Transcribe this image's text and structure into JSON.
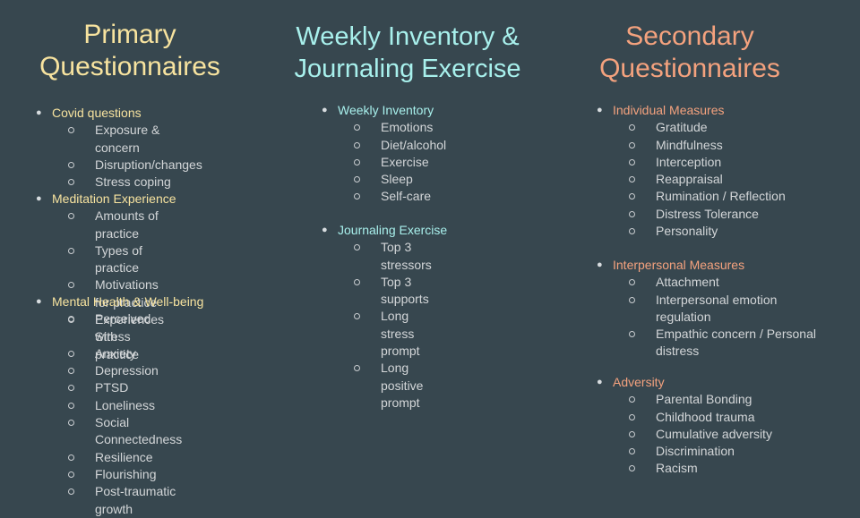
{
  "primary": {
    "title_line1": "Primary",
    "title_line2": "Questionnaires",
    "sections": [
      {
        "label": "Covid questions",
        "items": [
          "Exposure & concern",
          "Disruption/changes",
          "Stress coping"
        ]
      },
      {
        "label": "Meditation Experience",
        "items": [
          "Amounts of practice",
          "Types of practice",
          "Motivations for practice",
          "Experiences with practice"
        ]
      },
      {
        "label": "Mental Health & Well-being",
        "items": [
          "Perceived Stress",
          "Anxiety",
          "Depression",
          "PTSD",
          "Loneliness",
          "Social Connectedness",
          "Resilience",
          "Flourishing",
          "Post-traumatic growth"
        ]
      }
    ]
  },
  "weekly": {
    "title_line1": "Weekly Inventory &",
    "title_line2": "Journaling Exercise",
    "sections": [
      {
        "label": "Weekly Inventory",
        "items": [
          "Emotions",
          "Diet/alcohol",
          "Exercise",
          "Sleep",
          "Self-care"
        ]
      },
      {
        "label": "Journaling Exercise",
        "items": [
          "Top 3 stressors",
          "Top 3 supports",
          "Long stress prompt",
          "Long positive prompt"
        ]
      }
    ]
  },
  "secondary": {
    "title_line1": "Secondary",
    "title_line2": "Questionnaires",
    "sections": [
      {
        "label": "Individual Measures",
        "items": [
          "Gratitude",
          "Mindfulness",
          "Interception",
          "Reappraisal",
          "Rumination / Reflection",
          "Distress Tolerance",
          "Personality"
        ]
      },
      {
        "label": "Interpersonal Measures",
        "items": [
          "Attachment",
          "Interpersonal emotion regulation",
          "Empathic concern / Personal distress"
        ]
      },
      {
        "label": "Adversity",
        "items": [
          "Parental Bonding",
          "Childhood trauma",
          "Cumulative adversity",
          "Discrimination",
          "Racism"
        ]
      }
    ]
  },
  "colors": {
    "background": "#37474f",
    "primary_accent": "#f7e39f",
    "weekly_accent": "#a8f0ec",
    "secondary_accent": "#f4a27e",
    "body_text": "#d3d6d8"
  },
  "icons": {
    "top_bullet": "filled-circle-bullet",
    "sub_bullet": "hollow-circle-bullet"
  }
}
